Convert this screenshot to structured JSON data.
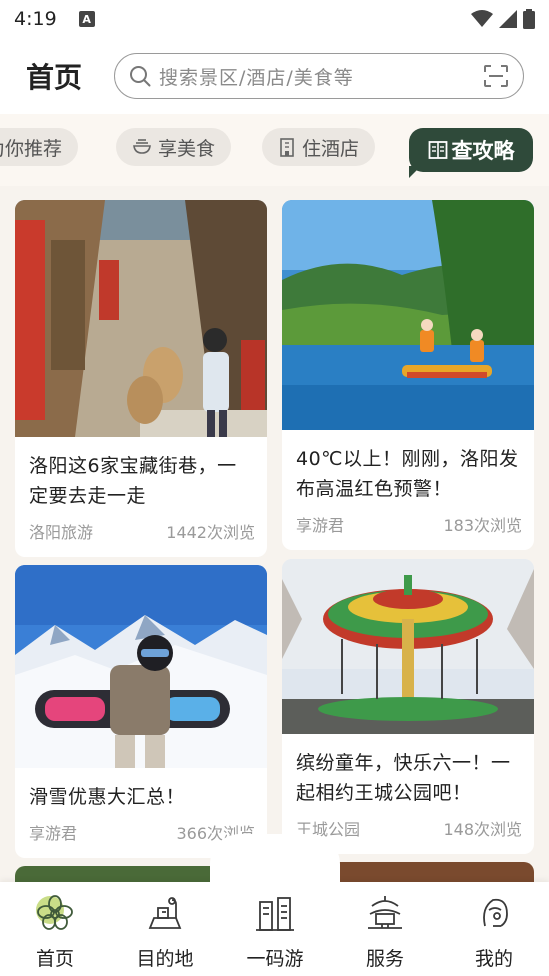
{
  "status_bar": {
    "time": "4:19",
    "notification_letter": "A"
  },
  "header": {
    "title": "首页",
    "search_placeholder": "搜索景区/酒店/美食等"
  },
  "tabs": [
    {
      "label": "为你推荐",
      "active": false
    },
    {
      "label": "享美食",
      "icon": "bowl-icon",
      "active": false
    },
    {
      "label": "住酒店",
      "icon": "hotel-icon",
      "active": false
    },
    {
      "label": "查攻略",
      "icon": "guide-book-icon",
      "active": true
    }
  ],
  "cards": [
    {
      "title": "洛阳这6家宝藏街巷，一定要去走一走",
      "author": "洛阳旅游",
      "views": "1442次浏览",
      "image": "old-street-photo"
    },
    {
      "title": "40℃以上！刚刚，洛阳发布高温红色预警！",
      "author": "享游君",
      "views": "183次浏览",
      "image": "river-rafting-photo"
    },
    {
      "title": "滑雪优惠大汇总！",
      "author": "享游君",
      "views": "366次浏览",
      "image": "skiing-photo"
    },
    {
      "title": "缤纷童年，快乐六一！一起相约王城公园吧！",
      "author": "王城公园",
      "views": "148次浏览",
      "image": "carousel-photo"
    }
  ],
  "bottom_nav": [
    {
      "label": "首页",
      "icon": "home-flower-icon",
      "active": true
    },
    {
      "label": "目的地",
      "icon": "destination-icon",
      "active": false
    },
    {
      "label": "一码游",
      "icon": "one-code-tour-icon",
      "active": false
    },
    {
      "label": "服务",
      "icon": "service-pagoda-icon",
      "active": false
    },
    {
      "label": "我的",
      "icon": "profile-icon",
      "active": false
    }
  ],
  "colors": {
    "accent": "#2f4a3a",
    "background": "#f7f3ee",
    "tab_inactive": "#ebe7e2"
  }
}
